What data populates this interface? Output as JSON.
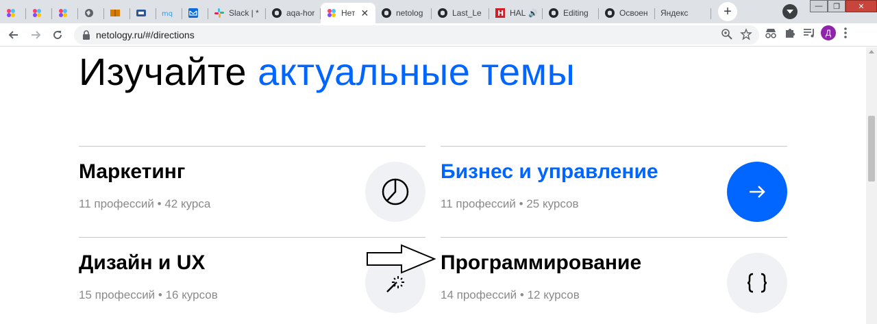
{
  "browser": {
    "tabs": [
      {
        "title": "",
        "icon": "netology-icon"
      },
      {
        "title": "",
        "icon": "netology-icon"
      },
      {
        "title": "",
        "icon": "netology-icon"
      },
      {
        "title": "",
        "icon": "globe-icon"
      },
      {
        "title": "",
        "icon": "book-icon"
      },
      {
        "title": "",
        "icon": "document-icon"
      },
      {
        "title": "",
        "icon": "mq-icon"
      },
      {
        "title": "",
        "icon": "mail-icon"
      },
      {
        "title": "Slack | *",
        "icon": "slack-icon"
      },
      {
        "title": "aqa-hor",
        "icon": "github-icon"
      },
      {
        "title": "Нет",
        "icon": "netology-icon",
        "active": true
      },
      {
        "title": "netolog",
        "icon": "github-icon"
      },
      {
        "title": "Last_Le",
        "icon": "github-icon"
      },
      {
        "title": "HAL",
        "icon": "hal-icon"
      },
      {
        "title": "Editing",
        "icon": "github-icon"
      },
      {
        "title": "Освоен",
        "icon": "github-icon"
      },
      {
        "title": "Яндекс",
        "icon": ""
      }
    ],
    "url": "netology.ru/#/directions",
    "profile_initial": "Д"
  },
  "page": {
    "headline_part1": "Изучайте",
    "headline_part2": "актуальные темы",
    "directions": [
      {
        "title": "Маркетинг",
        "meta": "11 профессий • 42 курса",
        "icon": "pie-chart-icon"
      },
      {
        "title": "Бизнес и управление",
        "meta": "11 профессий • 25 курсов",
        "icon": "arrow-right-icon"
      },
      {
        "title": "Дизайн и UX",
        "meta": "15 профессий • 16 курсов",
        "icon": "magic-wand-icon"
      },
      {
        "title": "Программирование",
        "meta": "14 профессий • 12 курсов",
        "icon": "curly-braces-icon"
      }
    ]
  },
  "colors": {
    "accent": "#0066ff",
    "meta_text": "#8a8a8a"
  }
}
